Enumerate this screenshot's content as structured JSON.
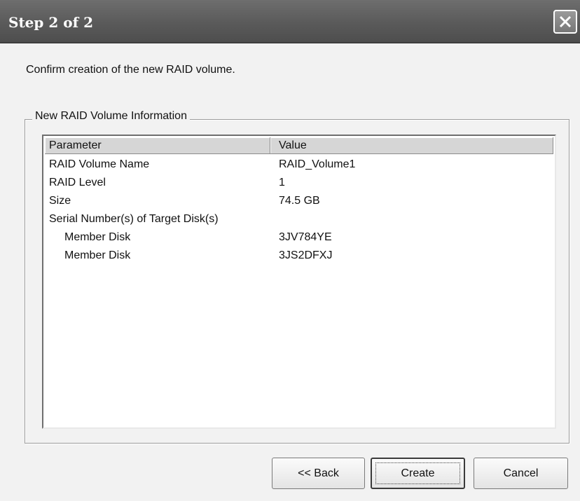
{
  "window": {
    "title": "Step 2 of 2"
  },
  "prompt": "Confirm creation of the new RAID volume.",
  "group": {
    "legend": "New RAID Volume Information"
  },
  "table": {
    "headers": {
      "parameter": "Parameter",
      "value": "Value"
    },
    "rows": [
      {
        "parameter": "RAID Volume Name",
        "value": "RAID_Volume1",
        "indent": false
      },
      {
        "parameter": "RAID Level",
        "value": "1",
        "indent": false
      },
      {
        "parameter": "Size",
        "value": "74.5 GB",
        "indent": false
      },
      {
        "parameter": "Serial Number(s) of Target Disk(s)",
        "value": "",
        "indent": false
      },
      {
        "parameter": "Member Disk",
        "value": "3JV784YE",
        "indent": true
      },
      {
        "parameter": "Member Disk",
        "value": "3JS2DFXJ",
        "indent": true
      }
    ]
  },
  "buttons": {
    "back": "<< Back",
    "create": "Create",
    "cancel": "Cancel"
  },
  "icons": {
    "close": "close-icon"
  },
  "colors": {
    "titlebar": "#5a5a5a",
    "dialog_background": "#f2f2f2"
  }
}
